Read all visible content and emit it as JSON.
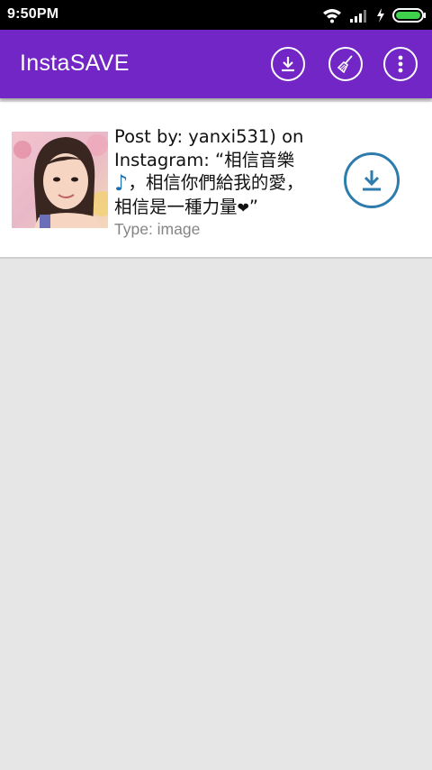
{
  "status_bar": {
    "time": "9:50PM",
    "icons": [
      "wifi-icon",
      "signal-icon",
      "charging-icon",
      "battery-icon"
    ]
  },
  "app_bar": {
    "title": "InstaSAVE",
    "background": "#7326c6",
    "actions": [
      "download-icon",
      "broom-icon",
      "more-vert-icon"
    ]
  },
  "post": {
    "caption_lines": [
      "Post by: yanxi531) on",
      "Instagram: “相信音樂",
      "，相信你們給我的愛，",
      "相信是一種力量",
      "”"
    ],
    "note_glyph": "♪",
    "heart_glyph": "❤",
    "type": "Type: image",
    "download_icon": "download-icon",
    "accent": "#2e7cad"
  }
}
